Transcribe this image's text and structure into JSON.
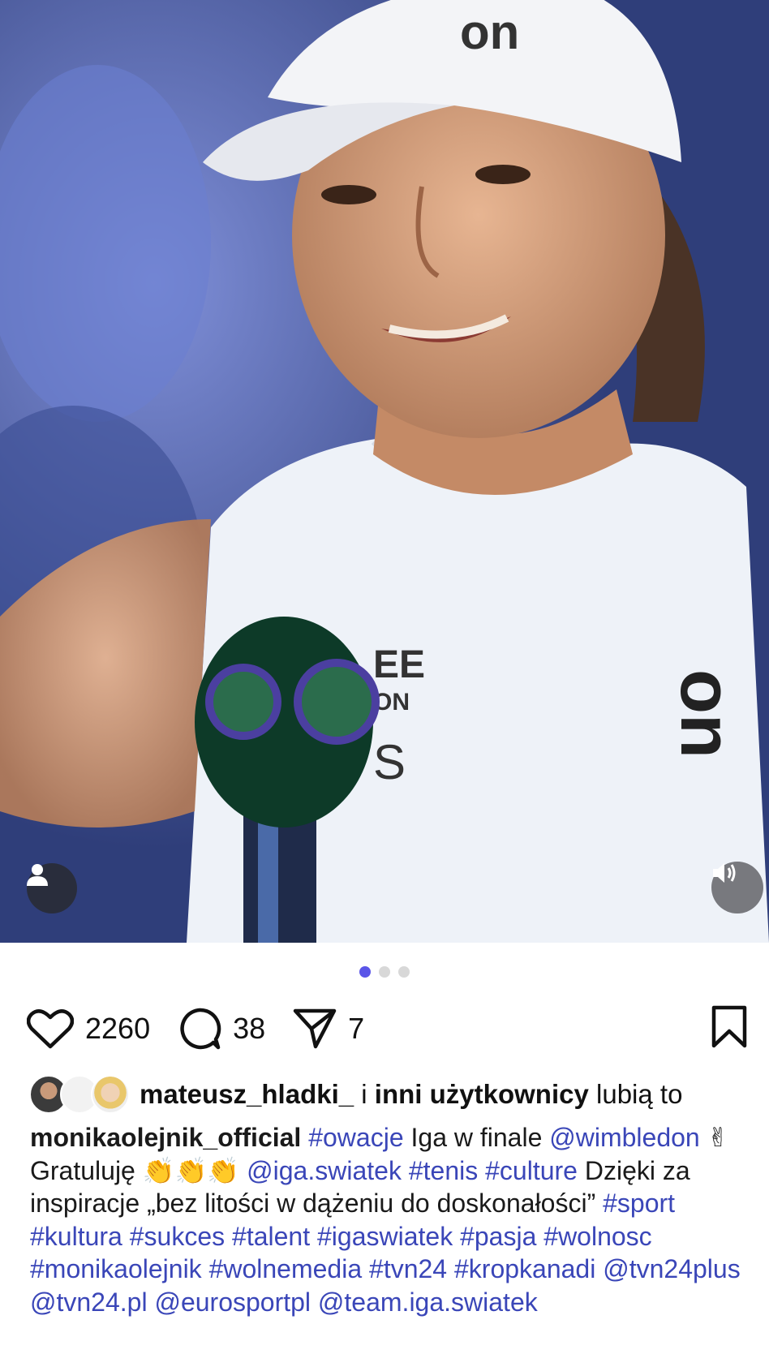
{
  "post": {
    "media": {
      "type": "photo",
      "description_icons": [
        "user-tag-icon",
        "speaker-icon"
      ],
      "carousel": {
        "total": 3,
        "active": 1
      }
    },
    "actions": {
      "likes": "2260",
      "comments": "38",
      "shares": "7"
    },
    "liked_by": {
      "user": "mateusz_hladki_",
      "connector": " i ",
      "others": "inni użytkownicy",
      "suffix": " lubią to"
    },
    "caption": {
      "author": "monikaolejnik_official",
      "segments": [
        {
          "t": "tag",
          "v": "#owacje"
        },
        {
          "t": "txt",
          "v": " Iga w finale "
        },
        {
          "t": "tag",
          "v": "@wimbledon"
        },
        {
          "t": "txt",
          "v": " ✌ Gratuluję 👏👏👏 "
        },
        {
          "t": "tag",
          "v": "@iga.swiatek"
        },
        {
          "t": "txt",
          "v": " "
        },
        {
          "t": "tag",
          "v": "#tenis"
        },
        {
          "t": "txt",
          "v": " "
        },
        {
          "t": "tag",
          "v": "#culture"
        },
        {
          "t": "txt",
          "v": " Dzięki za inspiracje „bez litości w dążeniu do doskonałości” "
        },
        {
          "t": "tag",
          "v": "#sport"
        },
        {
          "t": "txt",
          "v": " "
        },
        {
          "t": "tag",
          "v": "#kultura"
        },
        {
          "t": "txt",
          "v": " "
        },
        {
          "t": "tag",
          "v": "#sukces"
        },
        {
          "t": "txt",
          "v": " "
        },
        {
          "t": "tag",
          "v": "#talent"
        },
        {
          "t": "txt",
          "v": " "
        },
        {
          "t": "tag",
          "v": "#igaswiatek"
        },
        {
          "t": "txt",
          "v": " "
        },
        {
          "t": "tag",
          "v": "#pasja"
        },
        {
          "t": "txt",
          "v": " "
        },
        {
          "t": "tag",
          "v": "#wolnosc"
        },
        {
          "t": "txt",
          "v": " "
        },
        {
          "t": "tag",
          "v": "#monikaolejnik"
        },
        {
          "t": "txt",
          "v": " "
        },
        {
          "t": "tag",
          "v": "#wolnemedia"
        },
        {
          "t": "txt",
          "v": " "
        },
        {
          "t": "tag",
          "v": "#tvn24"
        },
        {
          "t": "txt",
          "v": " "
        },
        {
          "t": "tag",
          "v": "#kropkanadi"
        },
        {
          "t": "txt",
          "v": " "
        },
        {
          "t": "tag",
          "v": "@tvn24plus"
        },
        {
          "t": "txt",
          "v": " "
        },
        {
          "t": "tag",
          "v": "@tvn24.pl"
        },
        {
          "t": "txt",
          "v": " "
        },
        {
          "t": "tag",
          "v": "@eurosportpl"
        },
        {
          "t": "txt",
          "v": " "
        },
        {
          "t": "tag",
          "v": "@team.iga.swiatek"
        }
      ]
    },
    "colors": {
      "link": "#3a46b8",
      "carousel_active": "#5a55e8",
      "carousel_inactive": "#d8d8d8"
    }
  }
}
